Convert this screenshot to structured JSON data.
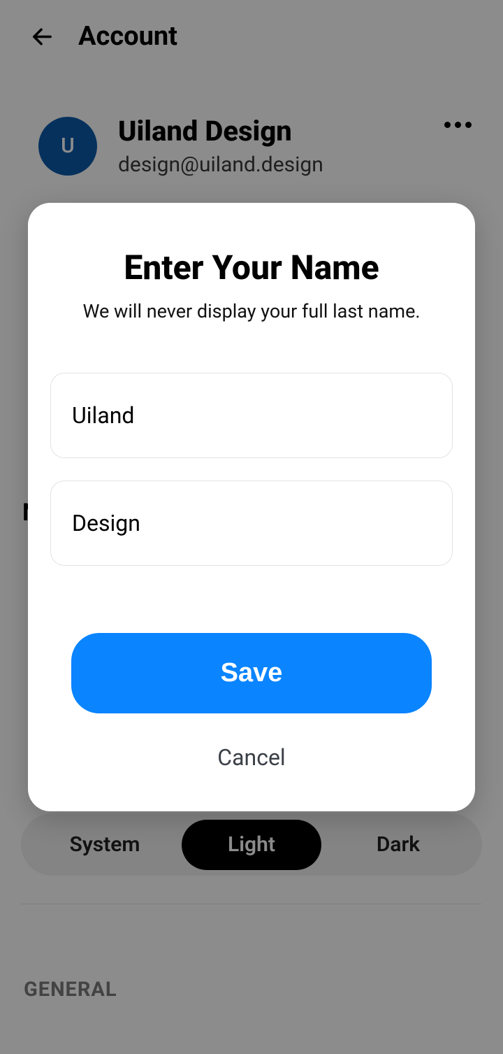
{
  "header": {
    "title": "Account"
  },
  "profile": {
    "avatar_initial": "U",
    "name": "Uiland Design",
    "email": "design@uiland.design"
  },
  "theme": {
    "options": [
      "System",
      "Light",
      "Dark"
    ],
    "selected": "Light"
  },
  "sections": {
    "general_label": "GENERAL",
    "clipped_left": "N"
  },
  "modal": {
    "title": "Enter Your Name",
    "subtitle": "We will never display your full last name.",
    "first_name_value": "Uiland",
    "last_name_value": "Design",
    "save_label": "Save",
    "cancel_label": "Cancel"
  },
  "colors": {
    "accent": "#0a84ff",
    "avatar_bg": "#0b5aaa"
  }
}
